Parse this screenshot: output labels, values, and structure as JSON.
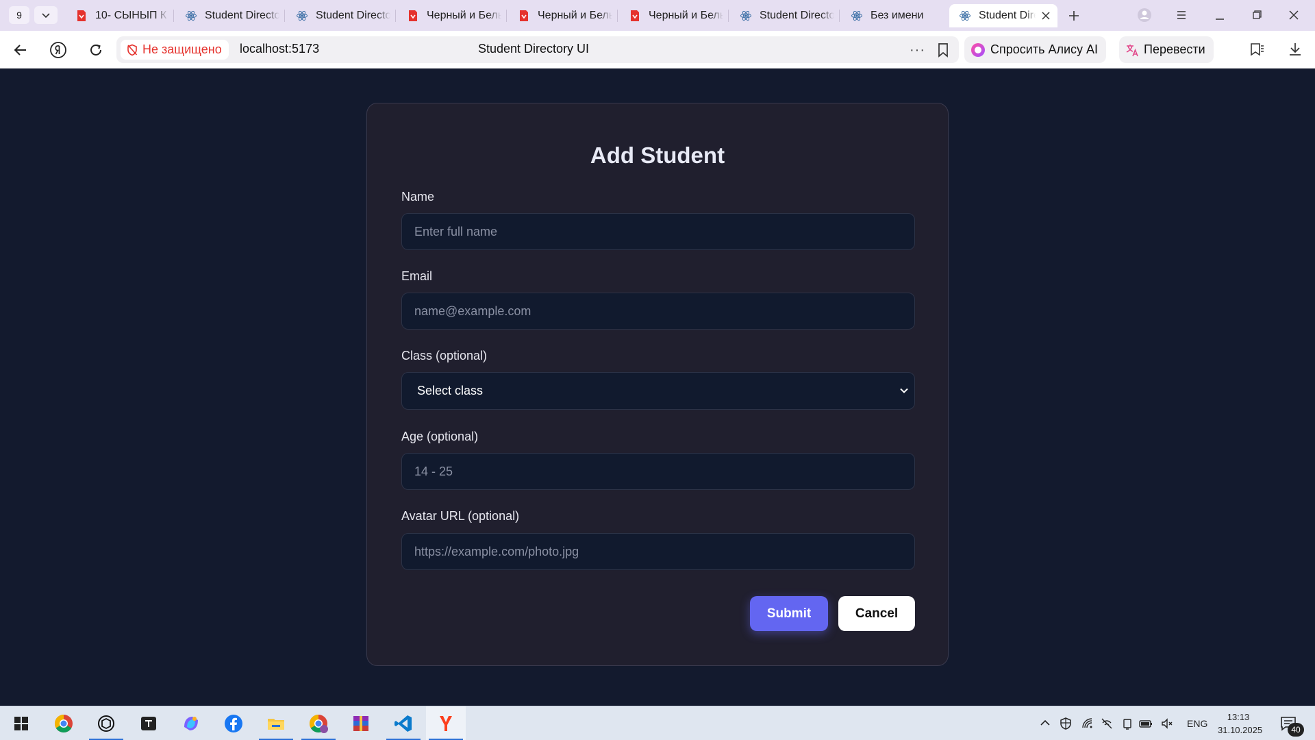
{
  "browser": {
    "tab_count": "9",
    "tabs": [
      {
        "title": "10- СЫНЫП К",
        "icon": "pdf-doc-icon"
      },
      {
        "title": "Student Directory",
        "icon": "react-icon"
      },
      {
        "title": "Student Directory",
        "icon": "react-icon"
      },
      {
        "title": "Черный и Белый",
        "icon": "pdf-doc-icon"
      },
      {
        "title": "Черный и Белый",
        "icon": "pdf-doc-icon"
      },
      {
        "title": "Черный и Белый",
        "icon": "pdf-doc-icon"
      },
      {
        "title": "Student Directory",
        "icon": "react-icon"
      },
      {
        "title": "Без имени",
        "icon": "react-icon"
      },
      {
        "title": "Student Directory",
        "icon": "react-icon",
        "active": true
      }
    ],
    "security_label": "Не защищено",
    "url": "localhost:5173",
    "page_title": "Student Directory UI",
    "alice_button": "Спросить Алису AI",
    "translate_button": "Перевести"
  },
  "form": {
    "title": "Add Student",
    "fields": {
      "name": {
        "label": "Name",
        "placeholder": "Enter full name"
      },
      "email": {
        "label": "Email",
        "placeholder": "name@example.com"
      },
      "class": {
        "label": "Class (optional)",
        "value": "Select class"
      },
      "age": {
        "label": "Age (optional)",
        "placeholder": "14 - 25"
      },
      "avatar": {
        "label": "Avatar URL (optional)",
        "placeholder": "https://example.com/photo.jpg"
      }
    },
    "submit_label": "Submit",
    "cancel_label": "Cancel"
  },
  "taskbar": {
    "apps": [
      "windows-start",
      "chrome",
      "chatgpt",
      "notes",
      "copilot",
      "facebook",
      "file-explorer",
      "chrome-profile",
      "winrar",
      "vscode",
      "yandex-browser"
    ],
    "language": "ENG",
    "time": "13:13",
    "date": "31.10.2025",
    "notification_count": "40"
  },
  "colors": {
    "page_bg": "#131a2e",
    "card_bg": "#201f2e",
    "input_bg": "#111a2e",
    "submit_bg": "#6366f1",
    "cancel_bg": "#ffffff",
    "insecure_red": "#e5322d"
  }
}
